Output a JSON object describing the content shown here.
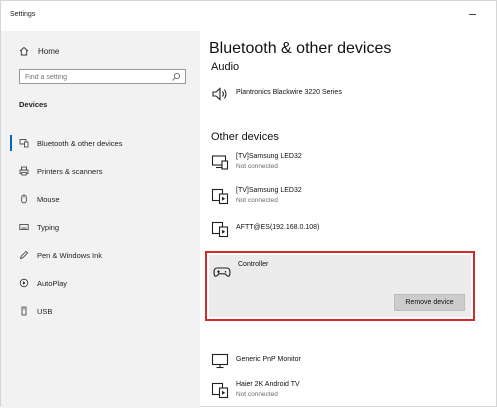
{
  "window": {
    "title": "Settings"
  },
  "sidebar": {
    "home_label": "Home",
    "search_placeholder": "Find a setting",
    "section_label": "Devices",
    "items": [
      {
        "label": "Bluetooth & other devices",
        "icon": "bluetooth-devices-icon",
        "selected": true
      },
      {
        "label": "Printers & scanners",
        "icon": "printer-icon"
      },
      {
        "label": "Mouse",
        "icon": "mouse-icon"
      },
      {
        "label": "Typing",
        "icon": "keyboard-icon"
      },
      {
        "label": "Pen & Windows Ink",
        "icon": "pen-icon"
      },
      {
        "label": "AutoPlay",
        "icon": "autoplay-icon"
      },
      {
        "label": "USB",
        "icon": "usb-icon"
      }
    ]
  },
  "main": {
    "title": "Bluetooth & other devices",
    "audio": {
      "heading": "Audio",
      "devices": [
        {
          "name": "Plantronics Blackwire 3220 Series",
          "icon": "speaker-icon"
        }
      ]
    },
    "other": {
      "heading": "Other devices",
      "devices": [
        {
          "name": "[TV]Samsung LED32",
          "status": "Not connected",
          "icon": "display-icon"
        },
        {
          "name": "[TV]Samsung LED32",
          "status": "Not connected",
          "icon": "media-device-icon"
        },
        {
          "name": "AFTT@ES(192.168.0.108)",
          "icon": "media-device-icon"
        },
        {
          "name": "Controller",
          "icon": "gamepad-icon",
          "selected": true,
          "action_label": "Remove device"
        },
        {
          "name": "Generic PnP Monitor",
          "icon": "monitor-icon"
        },
        {
          "name": "Haier 2K Android TV",
          "status": "Not connected",
          "icon": "media-device-icon"
        }
      ]
    }
  },
  "colors": {
    "accent": "#0067c0",
    "highlight_border": "#d42a2a",
    "sidebar_bg": "#f2f2f2"
  }
}
